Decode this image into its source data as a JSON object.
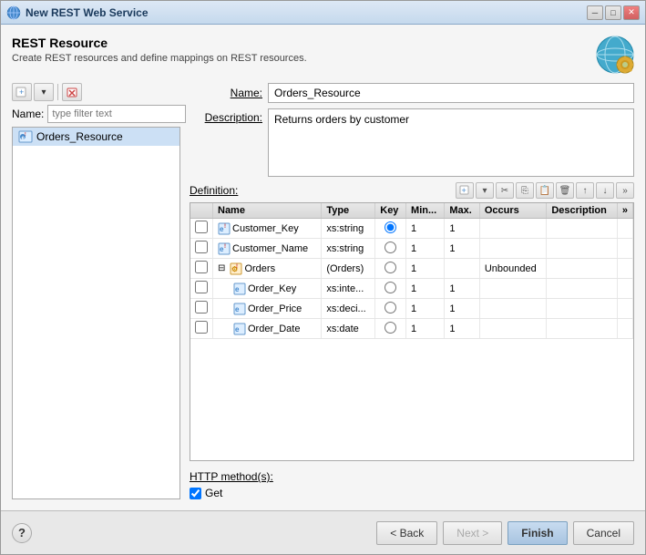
{
  "window": {
    "title": "New REST Web Service",
    "header": {
      "title": "REST Resource",
      "description": "Create REST resources and define mappings on REST resources."
    }
  },
  "left_panel": {
    "name_label": "Name:",
    "filter_placeholder": "type filter text",
    "resource_item": "Orders_Resource"
  },
  "right_panel": {
    "name_label": "Name:",
    "name_value": "Orders_Resource",
    "description_label": "Description:",
    "description_value": "Returns orders by customer",
    "definition_label": "Definition:",
    "table": {
      "headers": [
        "",
        "Name",
        "Type",
        "Key",
        "Min...",
        "Max.",
        "Occurs",
        "Description",
        "»"
      ],
      "rows": [
        {
          "indent": 0,
          "name": "Customer_Key",
          "type": "xs:string",
          "key": true,
          "min": "1",
          "max": "1",
          "occurs": "",
          "desc": ""
        },
        {
          "indent": 0,
          "name": "Customer_Name",
          "type": "xs:string",
          "key": false,
          "min": "1",
          "max": "1",
          "occurs": "",
          "desc": ""
        },
        {
          "indent": 0,
          "name": "Orders",
          "type": "(Orders)",
          "key": false,
          "min": "1",
          "max": "",
          "occurs": "Unbounded",
          "desc": ""
        },
        {
          "indent": 1,
          "name": "Order_Key",
          "type": "xs:inte...",
          "key": false,
          "min": "1",
          "max": "1",
          "occurs": "",
          "desc": ""
        },
        {
          "indent": 1,
          "name": "Order_Price",
          "type": "xs:deci...",
          "key": false,
          "min": "1",
          "max": "1",
          "occurs": "",
          "desc": ""
        },
        {
          "indent": 1,
          "name": "Order_Date",
          "type": "xs:date",
          "key": false,
          "min": "1",
          "max": "1",
          "occurs": "",
          "desc": ""
        }
      ]
    },
    "http_label": "HTTP method(s):",
    "get_label": "Get",
    "get_checked": true
  },
  "bottom": {
    "back_label": "< Back",
    "next_label": "Next >",
    "finish_label": "Finish",
    "cancel_label": "Cancel"
  }
}
